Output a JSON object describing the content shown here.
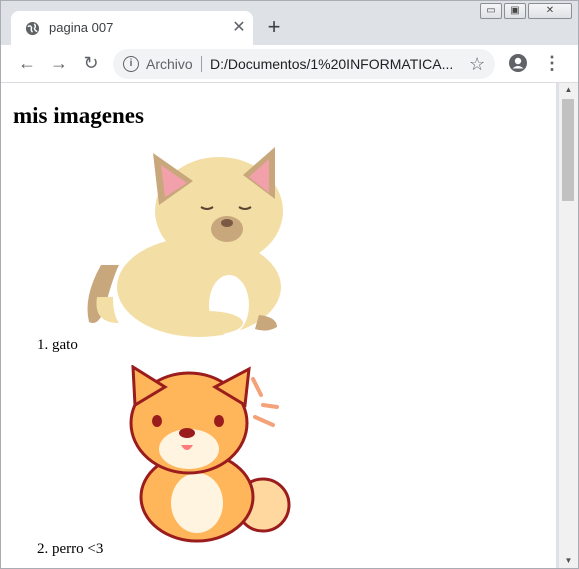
{
  "browser": {
    "tab": {
      "title": "pagina 007",
      "close_glyph": "✕",
      "favicon": "globe-icon"
    },
    "new_tab_glyph": "+",
    "window_controls": {
      "minimize": "▭",
      "maximize": "▣",
      "close": "✕"
    },
    "nav": {
      "back": "←",
      "forward": "→",
      "reload": "↻"
    },
    "omnibox": {
      "info_glyph": "i",
      "scheme_label": "Archivo",
      "url": "D:/Documentos/1%20INFORMATICA..."
    },
    "star_glyph": "☆",
    "menu_glyph": "⋮",
    "scroll": {
      "up": "▲",
      "down": "▼"
    }
  },
  "page": {
    "title": "mis imagenes",
    "items": [
      {
        "label": "1. gato",
        "image": "cat-illustration"
      },
      {
        "label": "2. perro <3",
        "image": "dog-illustration"
      }
    ]
  },
  "colors": {
    "tab_strip": "#dee1e6",
    "toolbar": "#ffffff",
    "omnibox": "#f1f3f4",
    "cat": "#f3dfa6",
    "dog": "#ffb65a",
    "dog_outline": "#9b1c1c"
  }
}
